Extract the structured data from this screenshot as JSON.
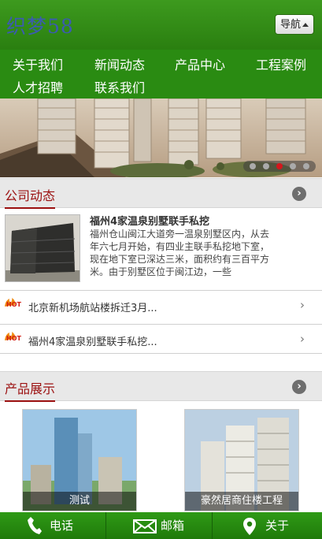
{
  "header": {
    "logo": "织梦58",
    "nav_button": "导航"
  },
  "menu": {
    "items": [
      "关于我们",
      "新闻动态",
      "产品中心",
      "工程案例",
      "人才招聘",
      "联系我们"
    ]
  },
  "banner": {
    "slide_count": 5,
    "active_slide": 3
  },
  "news": {
    "title": "公司动态",
    "feature": {
      "title": "福州4家温泉别墅联手私挖",
      "text": "福州仓山闽江大道旁一温泉别墅区内，从去年六七月开始，有四业主联手私挖地下室，现在地下室已深达三米，面积约有三百平方米。由于别墅区位于闽江边，一些"
    },
    "items": [
      {
        "badge": "HOT",
        "text": "北京新机场航站楼拆迁3月..."
      },
      {
        "badge": "HOT",
        "text": "福州4家温泉别墅联手私挖..."
      }
    ]
  },
  "products": {
    "title": "产品展示",
    "items": [
      {
        "caption": "测试"
      },
      {
        "caption": "豪然居商住楼工程"
      }
    ]
  },
  "footer": {
    "phone": "电话",
    "mail": "邮箱",
    "about": "关于"
  },
  "colors": {
    "header_green": "#2a8b12",
    "section_red": "#9b1010",
    "logo_blue": "#3b5bb0"
  }
}
